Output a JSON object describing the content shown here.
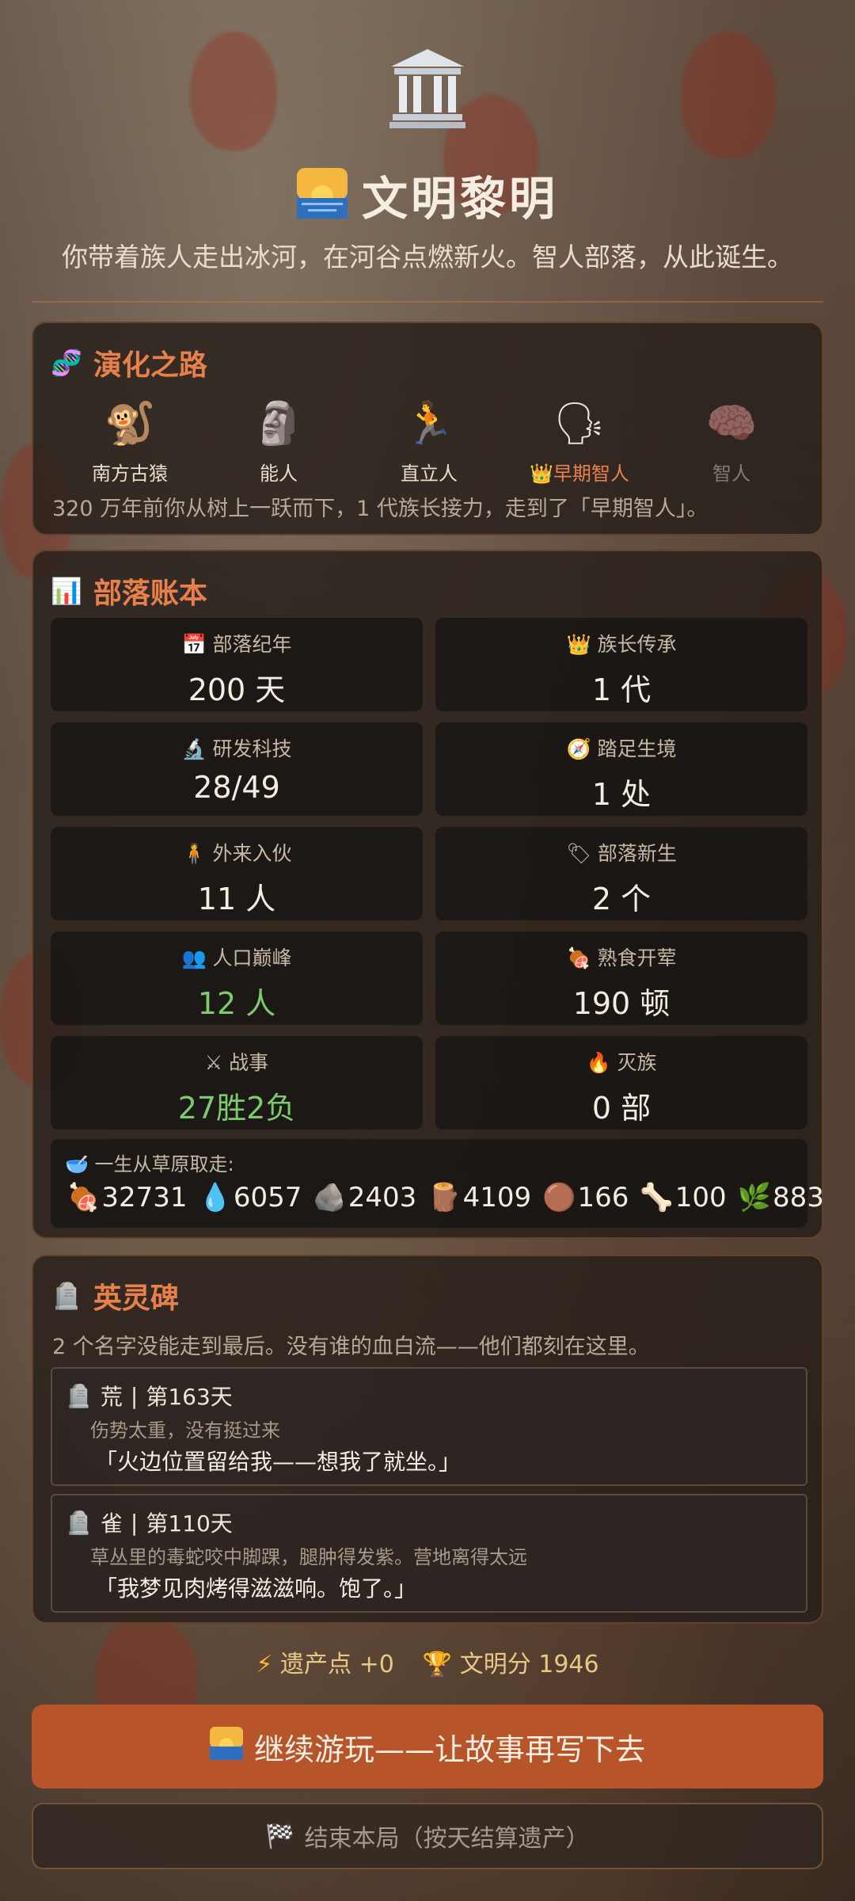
{
  "hero": {
    "icon": "classical-building-icon",
    "title_icon": "sunrise-icon",
    "title": "文明黎明",
    "subtitle": "你带着族人走出冰河，在河谷点燃新火。智人部落，从此诞生。"
  },
  "evolution": {
    "icon": "dna-icon",
    "title": "演化之路",
    "stages": [
      {
        "emoji": "🐒",
        "label": "南方古猿"
      },
      {
        "emoji": "🗿",
        "label": "能人"
      },
      {
        "emoji": "🏃",
        "label": "直立人"
      },
      {
        "emoji": "🗣",
        "label": "👑早期智人"
      },
      {
        "emoji": "🧠",
        "label": "智人"
      }
    ],
    "note": "320 万年前你从树上一跃而下，1 代族长接力，走到了「早期智人」。"
  },
  "ledger": {
    "icon": "bar-chart-icon",
    "title": "部落账本",
    "stats": [
      {
        "icon": "📅",
        "label": "部落纪年",
        "value": "200 天"
      },
      {
        "icon": "👑",
        "label": "族长传承",
        "value": "1 代"
      },
      {
        "icon": "🔬",
        "label": "研发科技",
        "value": "28/49"
      },
      {
        "icon": "🧭",
        "label": "踏足生境",
        "value": "1 处"
      },
      {
        "icon": "🧍",
        "label": "外来入伙",
        "value": "11 人"
      },
      {
        "icon": "🏷",
        "label": "部落新生",
        "value": "2 个"
      },
      {
        "icon": "👥",
        "label": "人口巅峰",
        "value": "12 人"
      },
      {
        "icon": "🍖",
        "label": "熟食开荤",
        "value": "190 顿"
      },
      {
        "icon": "⚔",
        "label": "战事",
        "value": "27胜2负"
      },
      {
        "icon": "🔥",
        "label": "灭族",
        "value": "0 部"
      }
    ],
    "loot_icon": "🥣",
    "loot_title": "一生从草原取走:",
    "loot": [
      {
        "icon": "🍖",
        "value": "32731"
      },
      {
        "icon": "💧",
        "value": "6057"
      },
      {
        "icon": "🪨",
        "value": "2403"
      },
      {
        "icon": "🪵",
        "value": "4109"
      },
      {
        "icon": "🟤",
        "value": "166"
      },
      {
        "icon": "🦴",
        "value": "100"
      },
      {
        "icon": "🌿",
        "value": "883"
      }
    ]
  },
  "memorial": {
    "icon": "headstone-icon",
    "title": "英灵碑",
    "note": "2 个名字没能走到最后。没有谁的血白流——他们都刻在这里。",
    "graves": [
      {
        "name": "荒",
        "sep": "|",
        "day": "第163天",
        "cause": "伤势太重，没有挺过来",
        "quote": "「火边位置留给我——想我了就坐。」"
      },
      {
        "name": "雀",
        "sep": "|",
        "day": "第110天",
        "cause": "草丛里的毒蛇咬中脚踝，腿肿得发紫。营地离得太远",
        "quote": "「我梦见肉烤得滋滋响。饱了。」"
      }
    ]
  },
  "scores": {
    "legacy_label": "遗产点 +0",
    "civ_label": "文明分 1946"
  },
  "buttons": {
    "continue": "继续游玩——让故事再写下去",
    "end": "结束本局（按天结算遗产）"
  }
}
